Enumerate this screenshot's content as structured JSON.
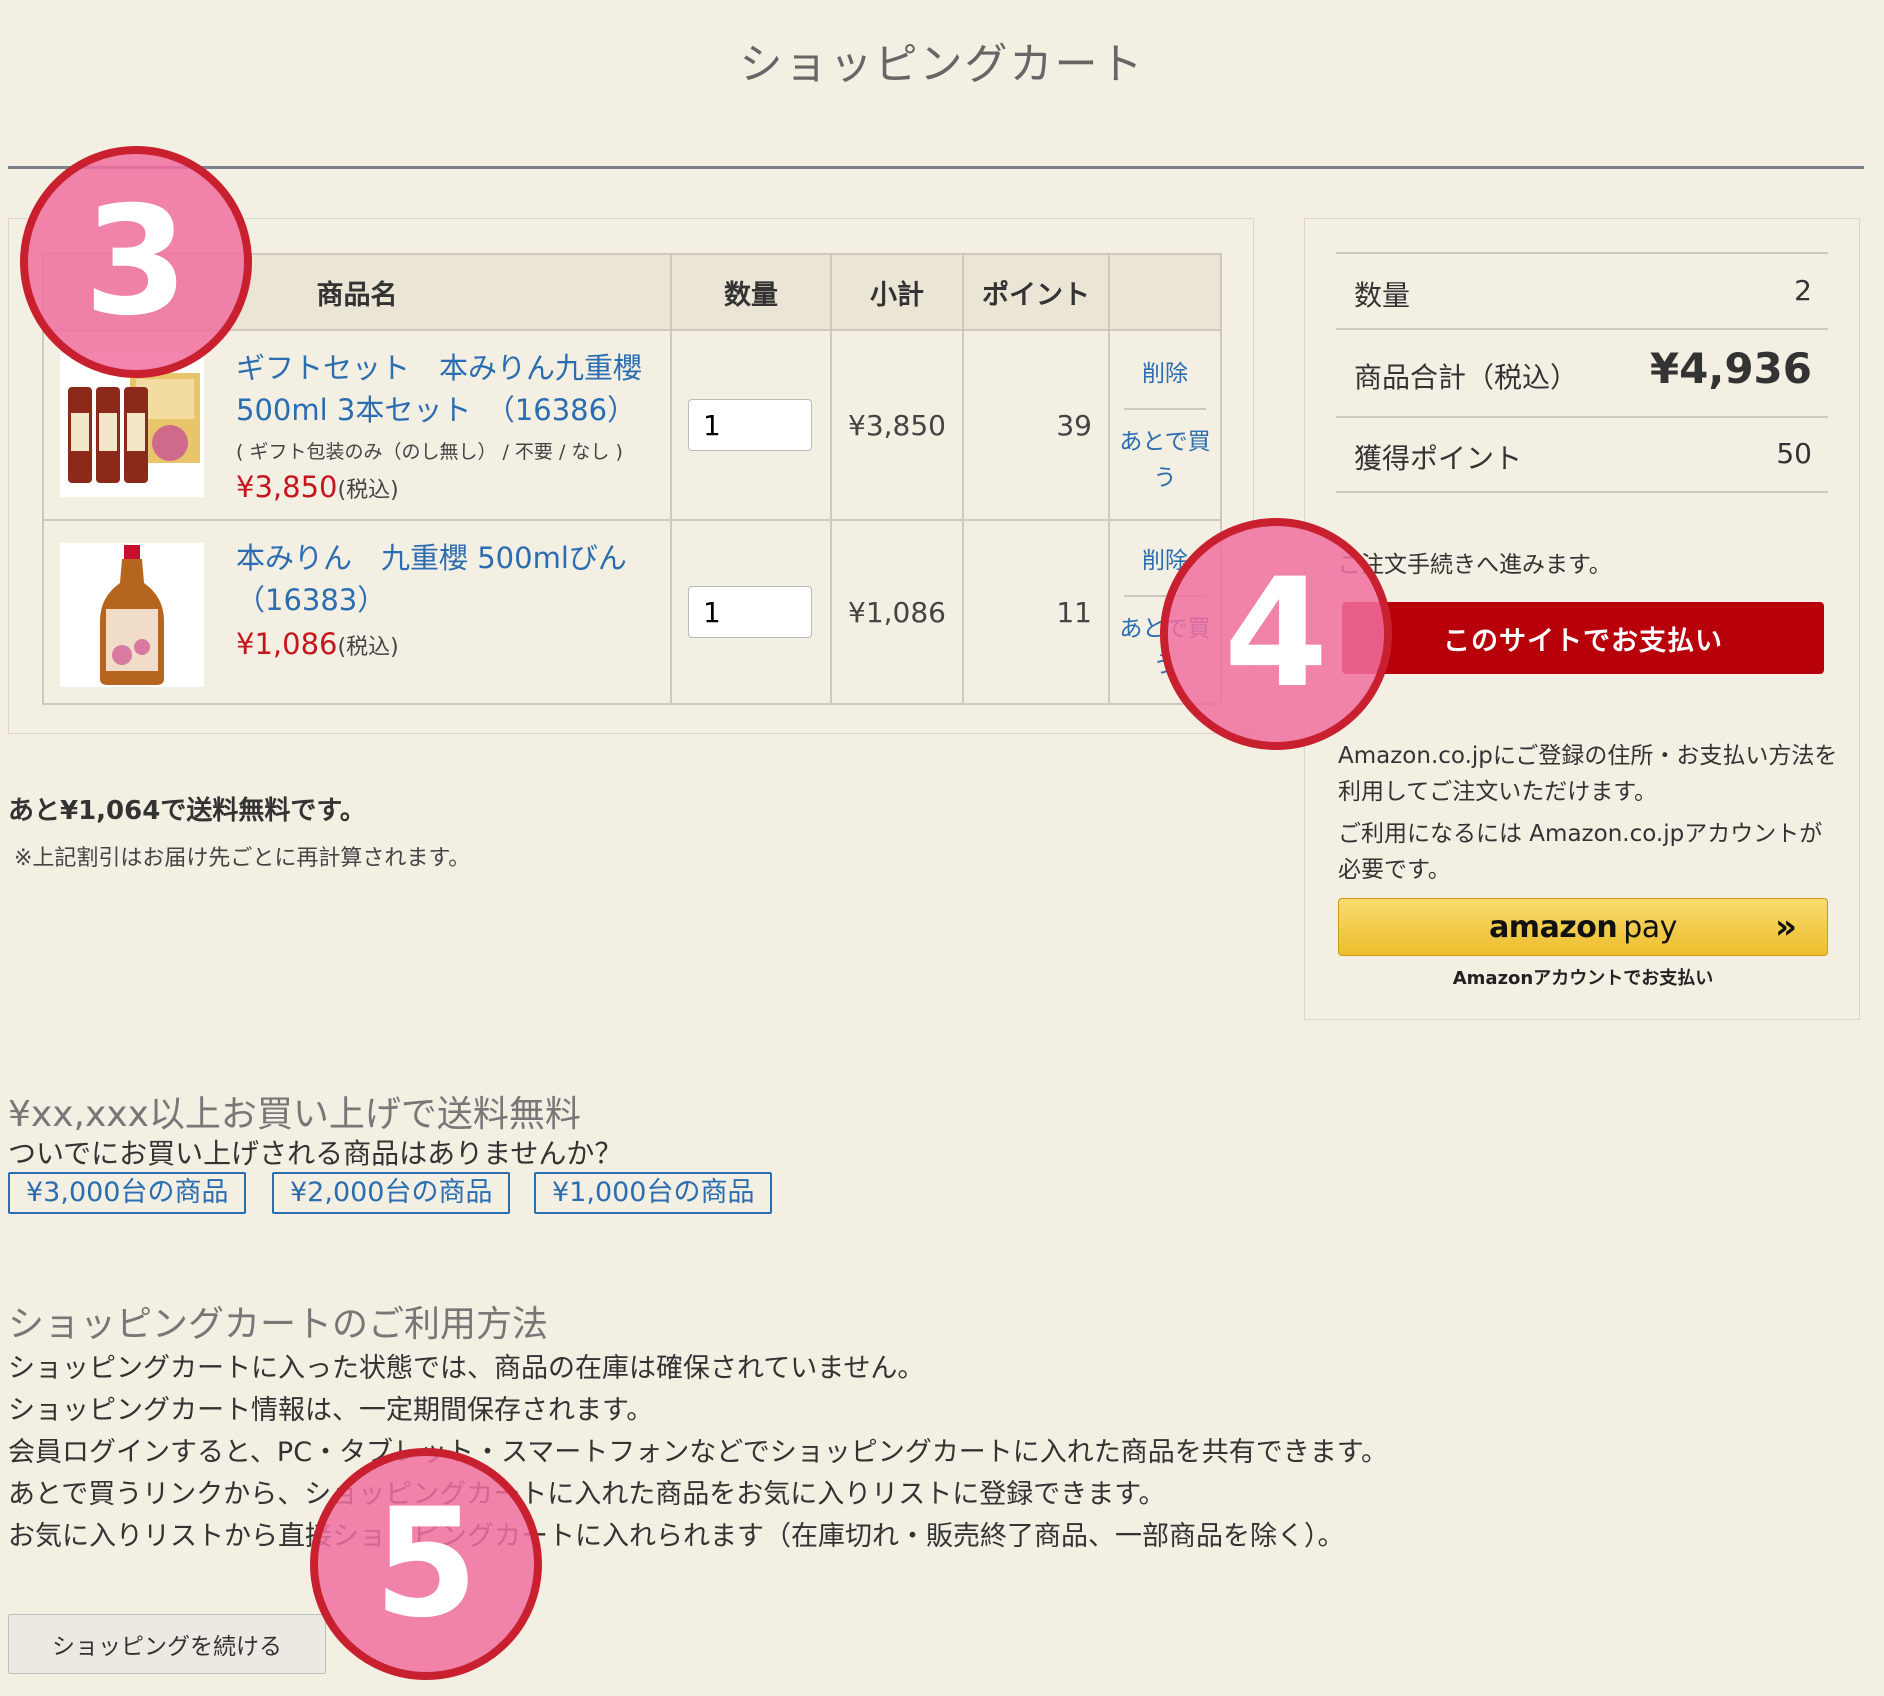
{
  "page": {
    "title": "ショッピングカート"
  },
  "cart": {
    "headers": {
      "product": "商品名",
      "qty": "数量",
      "subtotal": "小計",
      "points": "ポイント"
    },
    "items": [
      {
        "name": "ギフトセット　本みりん九重櫻500ml 3本セット　（16386）",
        "option": "( ギフト包装のみ（のし無し） / 不要 / なし )",
        "price": "¥3,850",
        "tax": "(税込)",
        "qty": "1",
        "subtotal": "¥3,850",
        "points": "39",
        "delete_label": "削除",
        "later_label": "あとで買う"
      },
      {
        "name": "本みりん　九重櫻 500mlびん（16383）",
        "option": "",
        "price": "¥1,086",
        "tax": "(税込)",
        "qty": "1",
        "subtotal": "¥1,086",
        "points": "11",
        "delete_label": "削除",
        "later_label": "あとで買う"
      }
    ],
    "free_shipping_msg": "あと¥1,064で送料無料です。",
    "recalc_note": "※上記割引はお届け先ごとに再計算されます。"
  },
  "summary": {
    "qty_label": "数量",
    "qty_value": "2",
    "total_label": "商品合計（税込）",
    "total_value": "¥4,936",
    "points_label": "獲得ポイント",
    "points_value": "50",
    "proceed_note": "ご注文手続きへ進みます。",
    "pay_site_button": "このサイトでお支払い",
    "amazon_text_1": "Amazon.co.jpにご登録の住所・お支払い方法を利用してご注文いただけます。",
    "amazon_text_2": "ご利用になるには Amazon.co.jpアカウントが必要です。",
    "amazon_logo": "amazon",
    "amazon_pay": "pay",
    "amazon_sub": "Amazonアカウントでお支払い"
  },
  "recommend": {
    "title": "¥xx,xxx以上お買い上げで送料無料",
    "subtitle": "ついでにお買い上げされる商品はありませんか？",
    "buttons": [
      "¥3,000台の商品",
      "¥2,000台の商品",
      "¥1,000台の商品"
    ]
  },
  "usage": {
    "title": "ショッピングカートのご利用方法",
    "lines": [
      "ショッピングカートに入った状態では、商品の在庫は確保されていません。",
      "ショッピングカート情報は、一定期間保存されます。",
      "会員ログインすると、PC・タブレット・スマートフォンなどでショッピングカートに入れた商品を共有できます。",
      "あとで買うリンクから、ショッピングカートに入れた商品をお気に入りリストに登録できます。",
      "お気に入りリストから直接ショッピングカートに入れられます（在庫切れ・販売終了商品、一部商品を除く）。"
    ]
  },
  "continue_button": "ショッピングを続ける",
  "badges": [
    "3",
    "4",
    "5"
  ]
}
